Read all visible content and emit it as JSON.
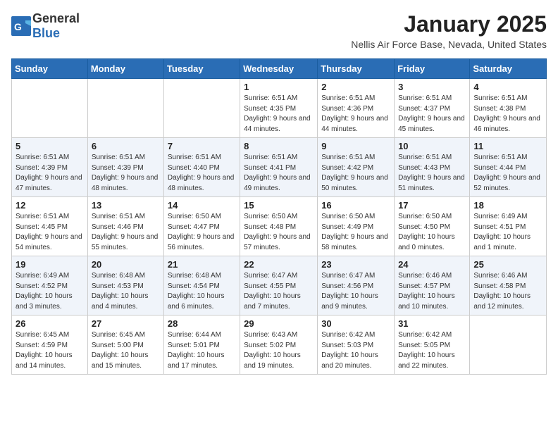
{
  "logo": {
    "general": "General",
    "blue": "Blue"
  },
  "title": "January 2025",
  "location": "Nellis Air Force Base, Nevada, United States",
  "days_of_week": [
    "Sunday",
    "Monday",
    "Tuesday",
    "Wednesday",
    "Thursday",
    "Friday",
    "Saturday"
  ],
  "weeks": [
    [
      {
        "day": "",
        "detail": ""
      },
      {
        "day": "",
        "detail": ""
      },
      {
        "day": "",
        "detail": ""
      },
      {
        "day": "1",
        "detail": "Sunrise: 6:51 AM\nSunset: 4:35 PM\nDaylight: 9 hours and 44 minutes."
      },
      {
        "day": "2",
        "detail": "Sunrise: 6:51 AM\nSunset: 4:36 PM\nDaylight: 9 hours and 44 minutes."
      },
      {
        "day": "3",
        "detail": "Sunrise: 6:51 AM\nSunset: 4:37 PM\nDaylight: 9 hours and 45 minutes."
      },
      {
        "day": "4",
        "detail": "Sunrise: 6:51 AM\nSunset: 4:38 PM\nDaylight: 9 hours and 46 minutes."
      }
    ],
    [
      {
        "day": "5",
        "detail": "Sunrise: 6:51 AM\nSunset: 4:39 PM\nDaylight: 9 hours and 47 minutes."
      },
      {
        "day": "6",
        "detail": "Sunrise: 6:51 AM\nSunset: 4:39 PM\nDaylight: 9 hours and 48 minutes."
      },
      {
        "day": "7",
        "detail": "Sunrise: 6:51 AM\nSunset: 4:40 PM\nDaylight: 9 hours and 48 minutes."
      },
      {
        "day": "8",
        "detail": "Sunrise: 6:51 AM\nSunset: 4:41 PM\nDaylight: 9 hours and 49 minutes."
      },
      {
        "day": "9",
        "detail": "Sunrise: 6:51 AM\nSunset: 4:42 PM\nDaylight: 9 hours and 50 minutes."
      },
      {
        "day": "10",
        "detail": "Sunrise: 6:51 AM\nSunset: 4:43 PM\nDaylight: 9 hours and 51 minutes."
      },
      {
        "day": "11",
        "detail": "Sunrise: 6:51 AM\nSunset: 4:44 PM\nDaylight: 9 hours and 52 minutes."
      }
    ],
    [
      {
        "day": "12",
        "detail": "Sunrise: 6:51 AM\nSunset: 4:45 PM\nDaylight: 9 hours and 54 minutes."
      },
      {
        "day": "13",
        "detail": "Sunrise: 6:51 AM\nSunset: 4:46 PM\nDaylight: 9 hours and 55 minutes."
      },
      {
        "day": "14",
        "detail": "Sunrise: 6:50 AM\nSunset: 4:47 PM\nDaylight: 9 hours and 56 minutes."
      },
      {
        "day": "15",
        "detail": "Sunrise: 6:50 AM\nSunset: 4:48 PM\nDaylight: 9 hours and 57 minutes."
      },
      {
        "day": "16",
        "detail": "Sunrise: 6:50 AM\nSunset: 4:49 PM\nDaylight: 9 hours and 58 minutes."
      },
      {
        "day": "17",
        "detail": "Sunrise: 6:50 AM\nSunset: 4:50 PM\nDaylight: 10 hours and 0 minutes."
      },
      {
        "day": "18",
        "detail": "Sunrise: 6:49 AM\nSunset: 4:51 PM\nDaylight: 10 hours and 1 minute."
      }
    ],
    [
      {
        "day": "19",
        "detail": "Sunrise: 6:49 AM\nSunset: 4:52 PM\nDaylight: 10 hours and 3 minutes."
      },
      {
        "day": "20",
        "detail": "Sunrise: 6:48 AM\nSunset: 4:53 PM\nDaylight: 10 hours and 4 minutes."
      },
      {
        "day": "21",
        "detail": "Sunrise: 6:48 AM\nSunset: 4:54 PM\nDaylight: 10 hours and 6 minutes."
      },
      {
        "day": "22",
        "detail": "Sunrise: 6:47 AM\nSunset: 4:55 PM\nDaylight: 10 hours and 7 minutes."
      },
      {
        "day": "23",
        "detail": "Sunrise: 6:47 AM\nSunset: 4:56 PM\nDaylight: 10 hours and 9 minutes."
      },
      {
        "day": "24",
        "detail": "Sunrise: 6:46 AM\nSunset: 4:57 PM\nDaylight: 10 hours and 10 minutes."
      },
      {
        "day": "25",
        "detail": "Sunrise: 6:46 AM\nSunset: 4:58 PM\nDaylight: 10 hours and 12 minutes."
      }
    ],
    [
      {
        "day": "26",
        "detail": "Sunrise: 6:45 AM\nSunset: 4:59 PM\nDaylight: 10 hours and 14 minutes."
      },
      {
        "day": "27",
        "detail": "Sunrise: 6:45 AM\nSunset: 5:00 PM\nDaylight: 10 hours and 15 minutes."
      },
      {
        "day": "28",
        "detail": "Sunrise: 6:44 AM\nSunset: 5:01 PM\nDaylight: 10 hours and 17 minutes."
      },
      {
        "day": "29",
        "detail": "Sunrise: 6:43 AM\nSunset: 5:02 PM\nDaylight: 10 hours and 19 minutes."
      },
      {
        "day": "30",
        "detail": "Sunrise: 6:42 AM\nSunset: 5:03 PM\nDaylight: 10 hours and 20 minutes."
      },
      {
        "day": "31",
        "detail": "Sunrise: 6:42 AM\nSunset: 5:05 PM\nDaylight: 10 hours and 22 minutes."
      },
      {
        "day": "",
        "detail": ""
      }
    ]
  ]
}
